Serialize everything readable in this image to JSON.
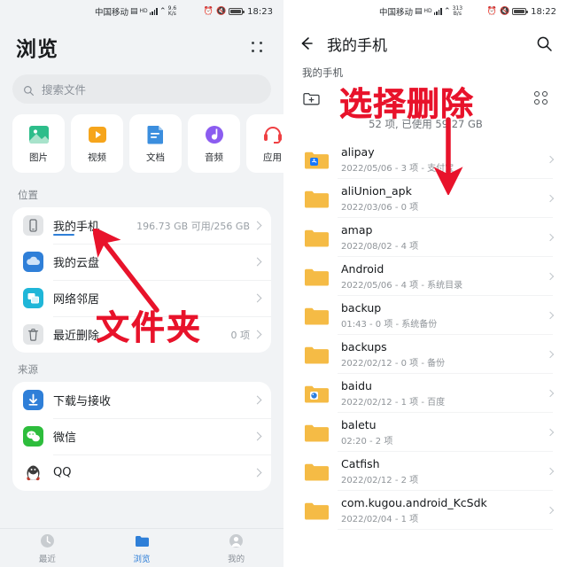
{
  "left": {
    "statusbar": {
      "carrier": "中国移动",
      "netspeed_value": "9.6",
      "netspeed_unit": "K/s",
      "time": "18:23",
      "icons": [
        "sim-icon",
        "signal-bars-icon",
        "wifi-icon",
        "alarm-icon",
        "mute-icon",
        "battery-icon"
      ]
    },
    "title": "浏览",
    "menu_icon": "four-dots-icon",
    "search": {
      "placeholder": "搜索文件",
      "icon": "search-icon"
    },
    "categories": [
      {
        "label": "图片",
        "icon": "image-icon",
        "color": "#2dbd8a"
      },
      {
        "label": "视频",
        "icon": "video-icon",
        "color": "#f6a51c"
      },
      {
        "label": "文档",
        "icon": "document-icon",
        "color": "#3b8ede"
      },
      {
        "label": "音频",
        "icon": "audio-icon",
        "color": "#8b5cf0"
      },
      {
        "label": "应用",
        "icon": "apps-icon",
        "color": "#ef3f42"
      }
    ],
    "location_section": {
      "title": "位置",
      "items": [
        {
          "label": "我的手机",
          "meta": "196.73 GB 可用/256 GB",
          "icon": "phone-icon",
          "selected": true
        },
        {
          "label": "我的云盘",
          "meta": "",
          "icon": "cloud-icon",
          "selected": false
        },
        {
          "label": "网络邻居",
          "meta": "",
          "icon": "network-icon",
          "selected": false
        },
        {
          "label": "最近删除",
          "meta": "0 项",
          "icon": "trash-icon",
          "selected": false
        }
      ]
    },
    "source_section": {
      "title": "来源",
      "items": [
        {
          "label": "下载与接收",
          "icon": "download-icon"
        },
        {
          "label": "微信",
          "icon": "wechat-icon"
        },
        {
          "label": "QQ",
          "icon": "qq-icon"
        }
      ]
    },
    "bottom_nav": [
      {
        "label": "最近",
        "icon": "clock-icon",
        "active": false
      },
      {
        "label": "浏览",
        "icon": "folder-icon",
        "active": true
      },
      {
        "label": "我的",
        "icon": "person-icon",
        "active": false
      }
    ],
    "annotation": {
      "text": "文件夹",
      "color": "#e8132b",
      "arrow": "arrow-up-right-to-my-phone"
    }
  },
  "right": {
    "statusbar": {
      "carrier": "中国移动",
      "netspeed_value": "313",
      "netspeed_unit": "B/s",
      "time": "18:22",
      "icons": [
        "sim-icon",
        "signal-bars-icon",
        "wifi-icon",
        "alarm-icon",
        "mute-icon",
        "battery-icon"
      ]
    },
    "back_icon": "back-arrow-icon",
    "title": "我的手机",
    "search_icon": "search-icon",
    "breadcrumb": "我的手机",
    "new_folder_icon": "new-folder-icon",
    "grid_view_icon": "grid-view-icon",
    "counts": "52 项, 已使用 59.27 GB",
    "annotation": {
      "text": "选择删除",
      "color": "#e8132b",
      "arrow": "arrow-down-to-list"
    },
    "files": [
      {
        "name": "alipay",
        "sub": "2022/05/06 - 3 项 - 支付宝",
        "badge": "alipay-icon"
      },
      {
        "name": "aliUnion_apk",
        "sub": "2022/03/06 - 0 项",
        "badge": ""
      },
      {
        "name": "amap",
        "sub": "2022/08/02 - 4 项",
        "badge": ""
      },
      {
        "name": "Android",
        "sub": "2022/05/06 - 4 项 - 系统目录",
        "badge": ""
      },
      {
        "name": "backup",
        "sub": "01:43 - 0 项 - 系统备份",
        "badge": ""
      },
      {
        "name": "backups",
        "sub": "2022/02/12 - 0 项 - 备份",
        "badge": ""
      },
      {
        "name": "baidu",
        "sub": "2022/02/12 - 1 项 - 百度",
        "badge": "baidu-icon"
      },
      {
        "name": "baletu",
        "sub": "02:20 - 2 项",
        "badge": ""
      },
      {
        "name": "Catfish",
        "sub": "2022/02/12 - 2 项",
        "badge": ""
      },
      {
        "name": "com.kugou.android_KcSdk",
        "sub": "2022/02/04 - 1 项",
        "badge": ""
      }
    ]
  }
}
